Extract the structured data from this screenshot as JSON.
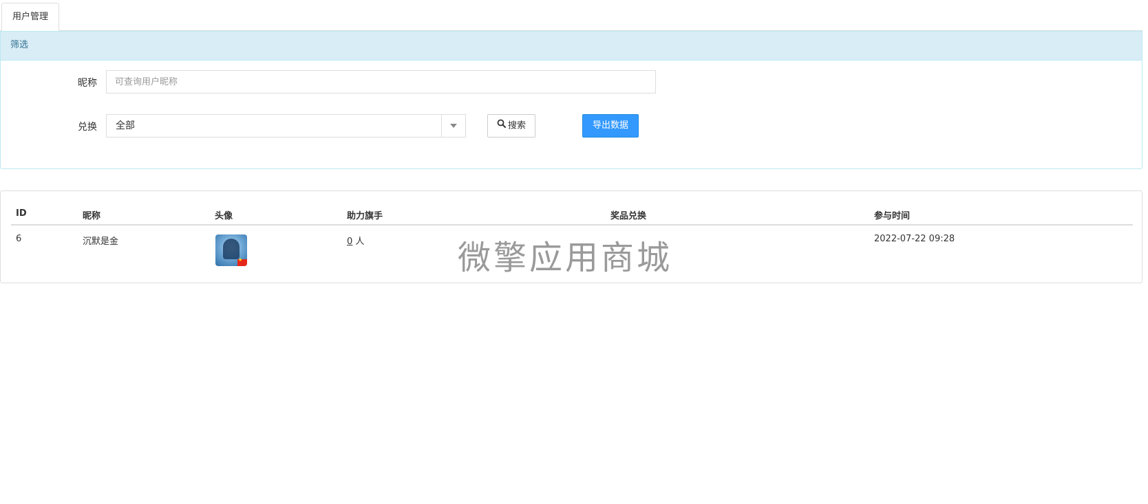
{
  "tabs": [
    {
      "label": "用户管理"
    }
  ],
  "filter": {
    "heading": "筛选",
    "nickname_label": "昵称",
    "nickname_placeholder": "可查询用户昵称",
    "nickname_value": "",
    "exchange_label": "兑换",
    "exchange_selected": "全部",
    "search_label": "搜索",
    "export_label": "导出数据"
  },
  "table": {
    "columns": [
      "ID",
      "昵称",
      "头像",
      "助力旗手",
      "奖品兑换",
      "参与时间"
    ],
    "rows": [
      {
        "id": "6",
        "nickname": "沉默是金",
        "helpers_count": "0",
        "helpers_unit": "人",
        "prize": "",
        "time": "2022-07-22 09:28"
      }
    ]
  },
  "watermark": "微擎应用商城",
  "colors": {
    "panel_heading_bg": "#d9edf7",
    "panel_heading_text": "#31708f",
    "export_button": "#3399ff"
  },
  "icons": {
    "search": "search-icon",
    "dropdown": "chevron-down-icon",
    "avatar_badge": "china-flag-icon"
  }
}
